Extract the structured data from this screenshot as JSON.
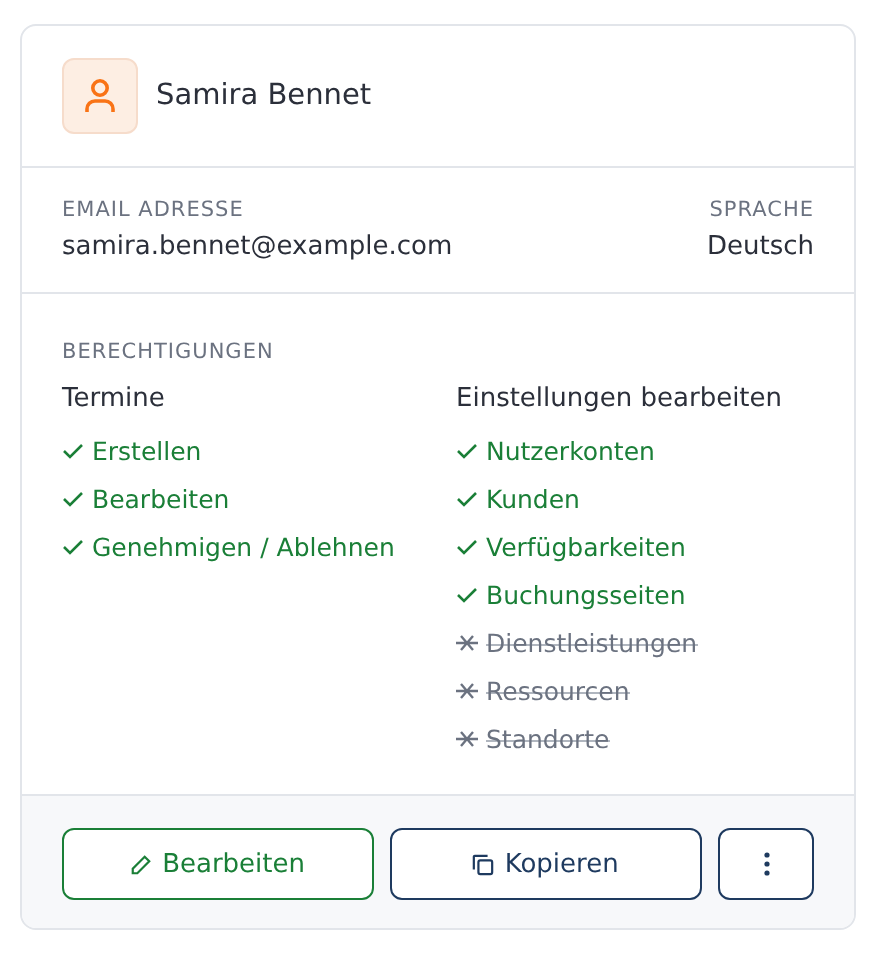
{
  "user": {
    "name": "Samira Bennet"
  },
  "details": [
    {
      "label": "EMAIL ADRESSE",
      "value": "samira.bennet@example.com"
    },
    {
      "label": "SPRACHE",
      "value": "Deutsch"
    }
  ],
  "permissions": {
    "title": "BERECHTIGUNGEN",
    "groups": [
      {
        "name": "Termine",
        "items": [
          {
            "label": "Erstellen",
            "granted": true
          },
          {
            "label": "Bearbeiten",
            "granted": true
          },
          {
            "label": "Genehmigen / Ablehnen",
            "granted": true
          }
        ]
      },
      {
        "name": "Einstellungen bearbeiten",
        "items": [
          {
            "label": "Nutzerkonten",
            "granted": true
          },
          {
            "label": "Kunden",
            "granted": true
          },
          {
            "label": "Verfügbarkeiten",
            "granted": true
          },
          {
            "label": "Buchungsseiten",
            "granted": true
          },
          {
            "label": "Dienstleistungen",
            "granted": false
          },
          {
            "label": "Ressourcen",
            "granted": false
          },
          {
            "label": "Standorte",
            "granted": false
          }
        ]
      }
    ]
  },
  "actions": [
    {
      "kind": "edit",
      "label": "Bearbeiten"
    },
    {
      "kind": "copy",
      "label": "Kopieren"
    },
    {
      "kind": "more"
    }
  ]
}
